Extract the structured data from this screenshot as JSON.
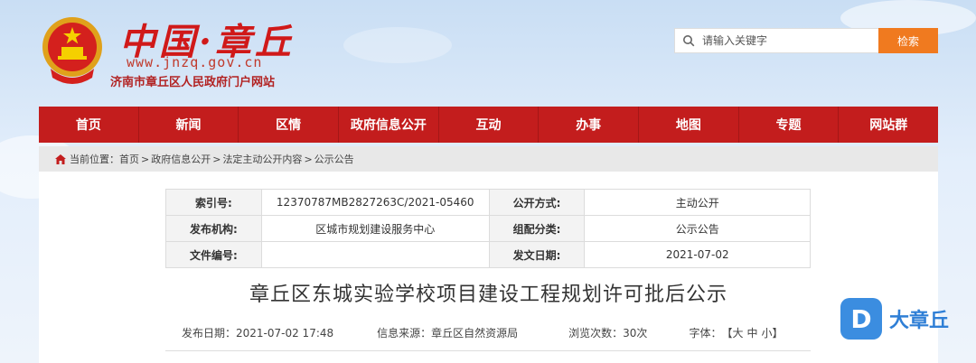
{
  "header": {
    "logo_main": "中国·章丘",
    "logo_url": "www.jnzq.gov.cn",
    "logo_subtitle": "济南市章丘区人民政府门户网站",
    "search_placeholder": "请输入关键字",
    "search_button": "检索"
  },
  "nav": {
    "items": [
      "首页",
      "新闻",
      "区情",
      "政府信息公开",
      "互动",
      "办事",
      "地图",
      "专题",
      "网站群"
    ]
  },
  "breadcrumb": {
    "prefix": "当前位置：",
    "items": [
      "首页",
      "政府信息公开",
      "法定主动公开内容",
      "公示公告"
    ],
    "separator": ">"
  },
  "info": {
    "index_label": "索引号:",
    "index_value": "12370787MB2827263C/2021-05460",
    "open_method_label": "公开方式:",
    "open_method_value": "主动公开",
    "publisher_label": "发布机构:",
    "publisher_value": "区城市规划建设服务中心",
    "category_label": "组配分类:",
    "category_value": "公示公告",
    "doc_no_label": "文件编号:",
    "doc_no_value": "",
    "issue_date_label": "发文日期:",
    "issue_date_value": "2021-07-02"
  },
  "article": {
    "title": "章丘区东城实验学校项目建设工程规划许可批后公示",
    "publish_date": "发布日期：2021-07-02 17:48",
    "source": "信息来源：章丘区自然资源局",
    "views": "浏览次数：30次",
    "font_label": "字体：",
    "font_open": "【",
    "font_large": "大",
    "font_medium": "中",
    "font_small": "小",
    "font_close": "】"
  },
  "watermark": {
    "badge": "D",
    "text": "大章丘"
  },
  "colors": {
    "nav_red": "#c31d1d",
    "search_orange": "#f07a1f",
    "logo_red": "#d01919",
    "watermark_blue": "#3b8de0"
  }
}
